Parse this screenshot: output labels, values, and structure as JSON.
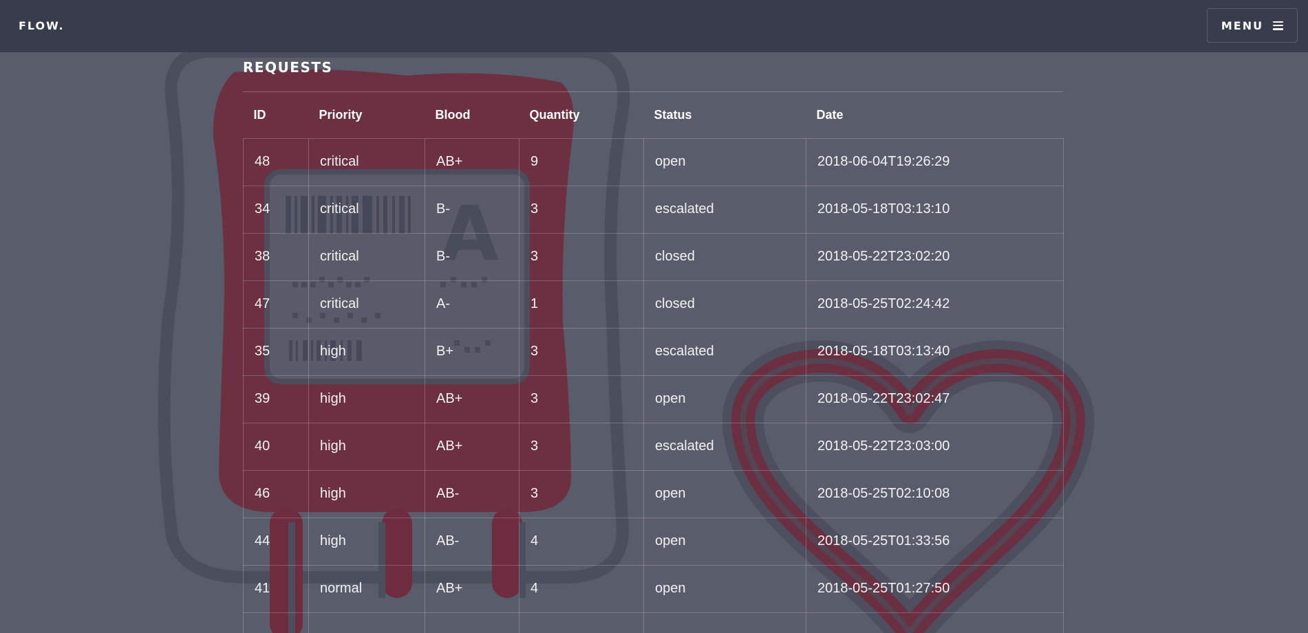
{
  "nav": {
    "brand": "FLOW.",
    "menu_label": "MENU",
    "menu_icon": "hamburger-icon"
  },
  "page": {
    "title": "REQUESTS"
  },
  "colors": {
    "navbar": "#393c4c",
    "background": "#595c6b",
    "blood_red": "#7a2a3c",
    "text": "#ffffff"
  },
  "table": {
    "headers": [
      "ID",
      "Priority",
      "Blood",
      "Quantity",
      "Status",
      "Date"
    ],
    "rows": [
      [
        "48",
        "critical",
        "AB+",
        "9",
        "open",
        "2018-06-04T19:26:29"
      ],
      [
        "34",
        "critical",
        "B-",
        "3",
        "escalated",
        "2018-05-18T03:13:10"
      ],
      [
        "38",
        "critical",
        "B-",
        "3",
        "closed",
        "2018-05-22T23:02:20"
      ],
      [
        "47",
        "critical",
        "A-",
        "1",
        "closed",
        "2018-05-25T02:24:42"
      ],
      [
        "35",
        "high",
        "B+",
        "3",
        "escalated",
        "2018-05-18T03:13:40"
      ],
      [
        "39",
        "high",
        "AB+",
        "3",
        "open",
        "2018-05-22T23:02:47"
      ],
      [
        "40",
        "high",
        "AB+",
        "3",
        "escalated",
        "2018-05-22T23:03:00"
      ],
      [
        "46",
        "high",
        "AB-",
        "3",
        "open",
        "2018-05-25T02:10:08"
      ],
      [
        "44",
        "high",
        "AB-",
        "4",
        "open",
        "2018-05-25T01:33:56"
      ],
      [
        "41",
        "normal",
        "AB+",
        "4",
        "open",
        "2018-05-25T01:27:50"
      ],
      [
        "",
        "",
        "",
        "",
        "",
        ""
      ]
    ]
  },
  "background_art": {
    "blood_bag_icon": "blood-bag-icon",
    "bag_label_text": "A",
    "heart_icon": "heart-icon"
  }
}
